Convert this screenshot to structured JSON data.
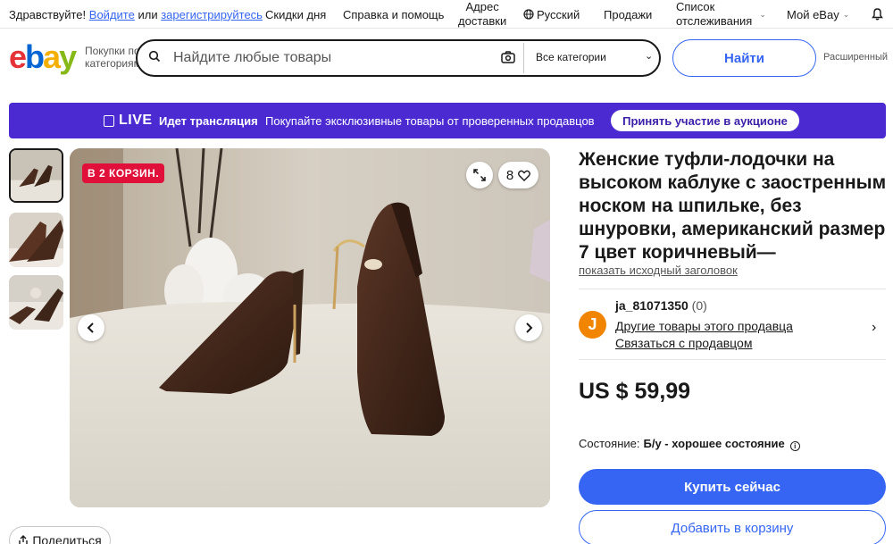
{
  "topbar": {
    "greeting": "Здравствуйте!",
    "sign_in": "Войдите",
    "or": "или",
    "register": "зарегистрируйтесь",
    "daily_deals": "Скидки дня",
    "help": "Справка и помощь",
    "ship_to_line1": "Адрес",
    "ship_to_line2": "доставки",
    "language": "Русский",
    "sell": "Продажи",
    "watchlist_line1": "Список",
    "watchlist_line2": "отслеживания",
    "my_ebay": "Мой eBay"
  },
  "header": {
    "logo": {
      "e": "e",
      "b": "b",
      "a": "a",
      "y": "y"
    },
    "shop_by_category": "Покупки по категориям",
    "search_placeholder": "Найдите любые товары",
    "category_select": "Все категории",
    "search_button": "Найти",
    "advanced": "Расширенный"
  },
  "banner": {
    "live": "LIVE",
    "streaming": "Идет трансляция",
    "text": "Покупайте эксклюзивные товары от проверенных продавцов",
    "button": "Принять участие в аукционе",
    "color": "#4b2bd1"
  },
  "gallery": {
    "badge": "В 2 КОРЗИН.",
    "watch_count": "8",
    "share": "Поделиться"
  },
  "listing": {
    "title": "Женские туфли-лодочки на высоком каблуке с заостренным носком на шпильке, без шнуровки, американский размер 7 цвет коричневый—",
    "show_original_title": "показать исходный заголовок",
    "seller_initial": "J",
    "seller_name": "ja_81071350",
    "seller_feedback": "(0)",
    "seller_other_items": "Другие товары этого продавца",
    "contact_seller": "Связаться с продавцом",
    "price": "US $ 59,99",
    "condition_label": "Состояние:",
    "condition_value": "Б/у - хорошее состояние",
    "buy_now": "Купить сейчас",
    "add_to_cart": "Добавить в корзину",
    "accent_color": "#3665f3"
  }
}
